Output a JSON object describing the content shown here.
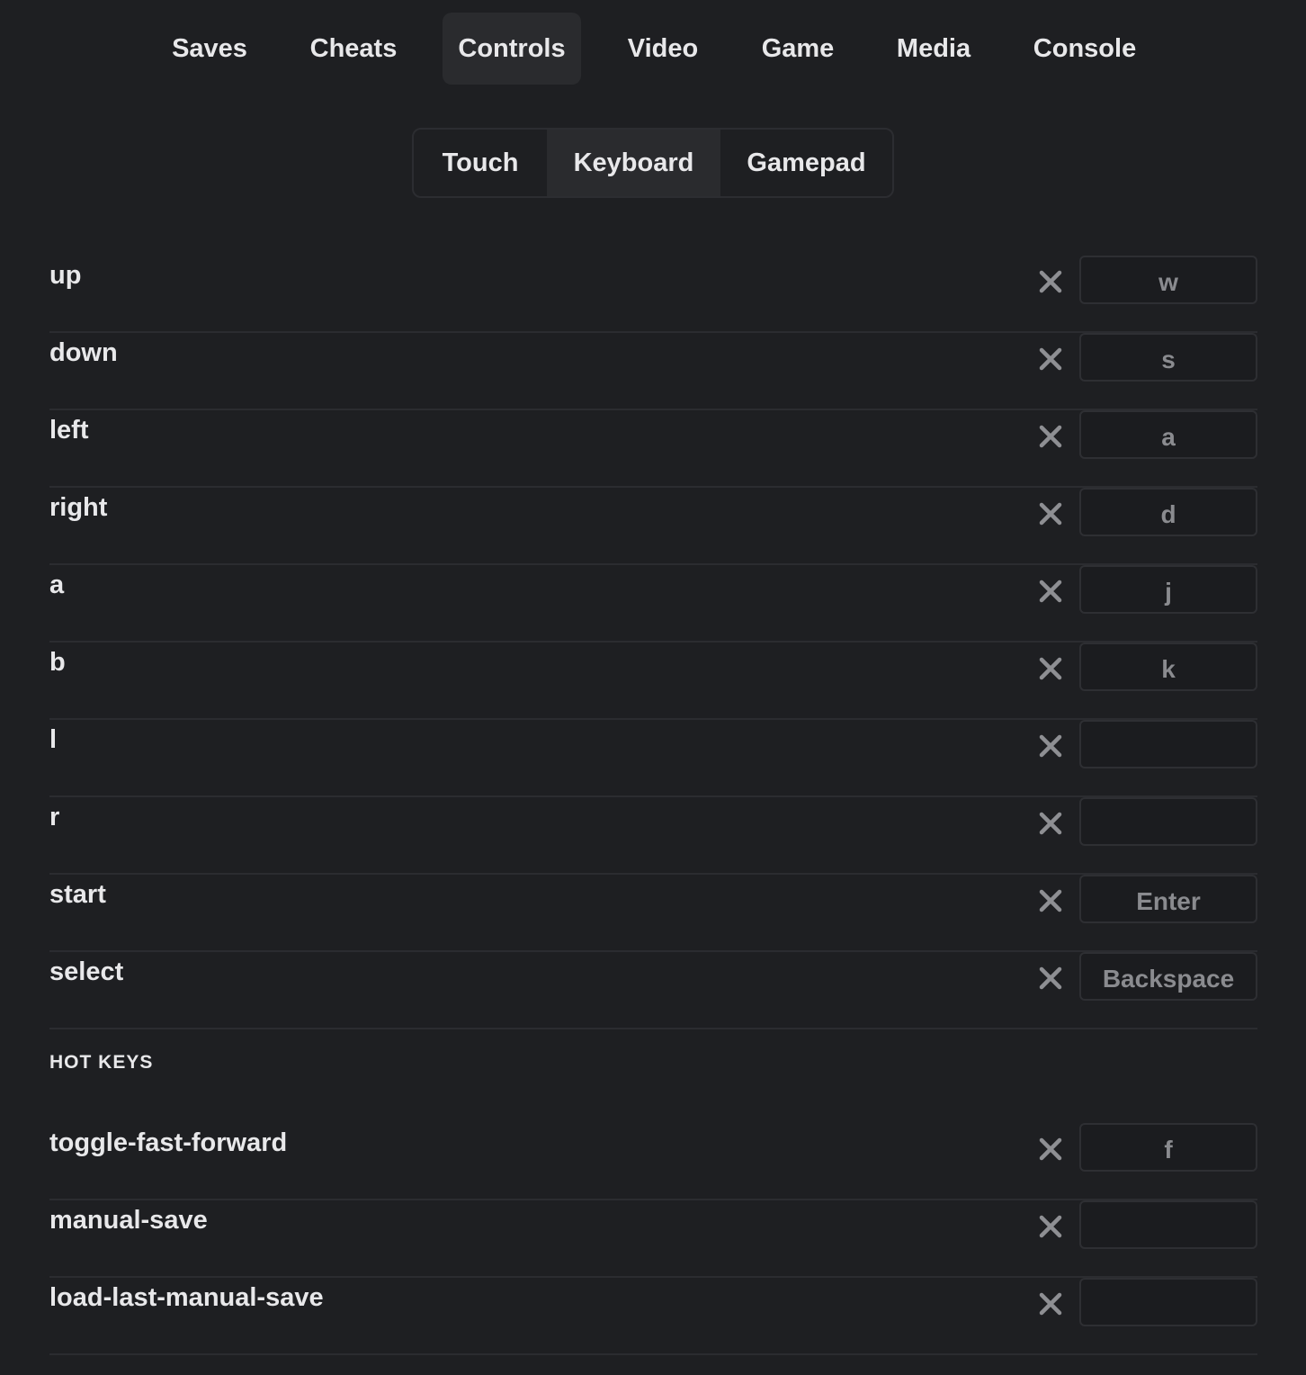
{
  "top_tabs": [
    {
      "label": "Saves"
    },
    {
      "label": "Cheats"
    },
    {
      "label": "Controls",
      "active": true
    },
    {
      "label": "Video"
    },
    {
      "label": "Game"
    },
    {
      "label": "Media"
    },
    {
      "label": "Console"
    }
  ],
  "control_modes": [
    {
      "label": "Touch"
    },
    {
      "label": "Keyboard",
      "active": true
    },
    {
      "label": "Gamepad"
    }
  ],
  "bindings": [
    {
      "action": "up",
      "key": "w"
    },
    {
      "action": "down",
      "key": "s"
    },
    {
      "action": "left",
      "key": "a"
    },
    {
      "action": "right",
      "key": "d"
    },
    {
      "action": "a",
      "key": "j"
    },
    {
      "action": "b",
      "key": "k"
    },
    {
      "action": "l",
      "key": ""
    },
    {
      "action": "r",
      "key": ""
    },
    {
      "action": "start",
      "key": "Enter"
    },
    {
      "action": "select",
      "key": "Backspace"
    }
  ],
  "hotkeys_heading": "HOT KEYS",
  "hotkeys": [
    {
      "action": "toggle-fast-forward",
      "key": "f"
    },
    {
      "action": "manual-save",
      "key": ""
    },
    {
      "action": "load-last-manual-save",
      "key": ""
    }
  ],
  "icons": {
    "clear": "close-icon"
  },
  "colors": {
    "background": "#1e1f22",
    "active_tab": "#2a2b2e",
    "text": "#e8e8ea",
    "muted_text": "#8a8b8f",
    "clear_icon": "#8e8f93"
  }
}
